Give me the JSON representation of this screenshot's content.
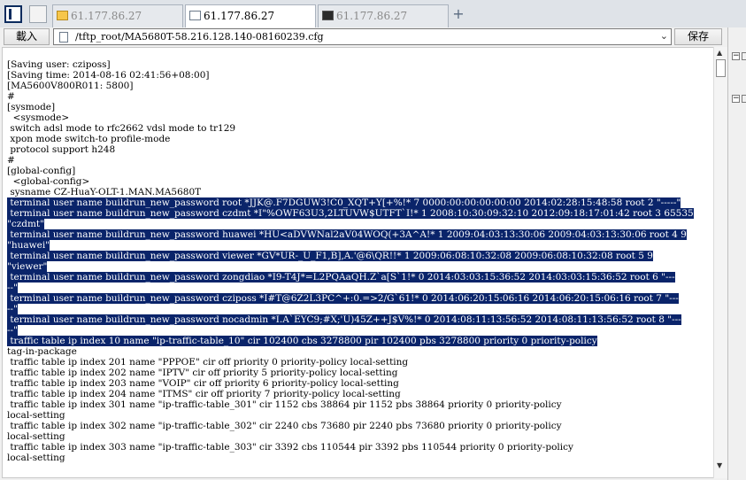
{
  "tabs": [
    {
      "label": "61.177.86.27",
      "icon": "folder-icon"
    },
    {
      "label": "61.177.86.27",
      "icon": "document-icon"
    },
    {
      "label": "61.177.86.27",
      "icon": "terminal-icon"
    }
  ],
  "add_tab": "+",
  "toolbar": {
    "load_label": "載入",
    "path": "/tftp_root/MA5680T-58.216.128.140-08160239.cfg",
    "save_label": "保存"
  },
  "editor": {
    "lines": [
      "[Saving user: cziposs]",
      "[Saving time: 2014-08-16 02:41:56+08:00]",
      "[MA5600V800R011: 5800]",
      "#",
      "[sysmode]",
      "  <sysmode>",
      " switch adsl mode to rfc2662 vdsl mode to tr129",
      " xpon mode switch-to profile-mode",
      " protocol support h248",
      "#",
      "[global-config]",
      "  <global-config>",
      " sysname CZ-HuaY-OLT-1.MAN.MA5680T"
    ],
    "selected_lines": [
      " terminal user name buildrun_new_password root *JJK@.F7DGUW3!C0_XQT+Y[+%!* 7 0000:00:00:00:00:00 2014:02:28:15:48:58 root 2 \"-----\"",
      " terminal user name buildrun_new_password czdmt *I\"%OWF63U3,2LTUVW$UTFT`I!* 1 2008:10:30:09:32:10 2012:09:18:17:01:42 root 3 65535",
      "\"czdmt\"",
      " terminal user name buildrun_new_password huawei *HU<aDVWNal2aV04WOQ(+3A^A!* 1 2009:04:03:13:30:06 2009:04:03:13:30:06 root 4 9",
      "\"huawei\"",
      " terminal user name buildrun_new_password viewer *GV*UR-_U_F1,B],A.'@6\\QR!!* 1 2009:06:08:10:32:08 2009:06:08:10:32:08 root 5 9",
      "\"viewer\"",
      " terminal user name buildrun_new_password zongdiao *I9-T4J*=L2PQAaQH.Z`a[S`1!* 0 2014:03:03:15:36:52 2014:03:03:15:36:52 root 6 \"---",
      "--\"",
      " terminal user name buildrun_new_password cziposs *I#T@6Z2L3PC^+:0.=>2/G`61!* 0 2014:06:20:15:06:16 2014:06:20:15:06:16 root 7 \"---",
      "--\"",
      " terminal user name buildrun_new_password nocadmin *I.A`EYC9;#X;'U)45Z++J$V%!* 0 2014:08:11:13:56:52 2014:08:11:13:56:52 root 8 \"---",
      "--\"",
      " traffic table ip index 10 name \"ip-traffic-table_10\" cir 102400 cbs 3278800 pir 102400 pbs 3278800 priority 0 priority-policy"
    ],
    "after_lines": [
      "tag-in-package",
      " traffic table ip index 201 name \"PPPOE\" cir off priority 0 priority-policy local-setting",
      " traffic table ip index 202 name \"IPTV\" cir off priority 5 priority-policy local-setting",
      " traffic table ip index 203 name \"VOIP\" cir off priority 6 priority-policy local-setting",
      " traffic table ip index 204 name \"ITMS\" cir off priority 7 priority-policy local-setting",
      " traffic table ip index 301 name \"ip-traffic-table_301\" cir 1152 cbs 38864 pir 1152 pbs 38864 priority 0 priority-policy",
      "local-setting",
      " traffic table ip index 302 name \"ip-traffic-table_302\" cir 2240 cbs 73680 pir 2240 pbs 73680 priority 0 priority-policy",
      "local-setting",
      " traffic table ip index 303 name \"ip-traffic-table_303\" cir 3392 cbs 110544 pir 3392 pbs 110544 priority 0 priority-policy",
      "local-setting"
    ]
  },
  "side": {
    "collapse1": "−",
    "collapse2": "−"
  },
  "colors": {
    "selection": "#0a246a",
    "tabbar": "#dfe3e8"
  }
}
